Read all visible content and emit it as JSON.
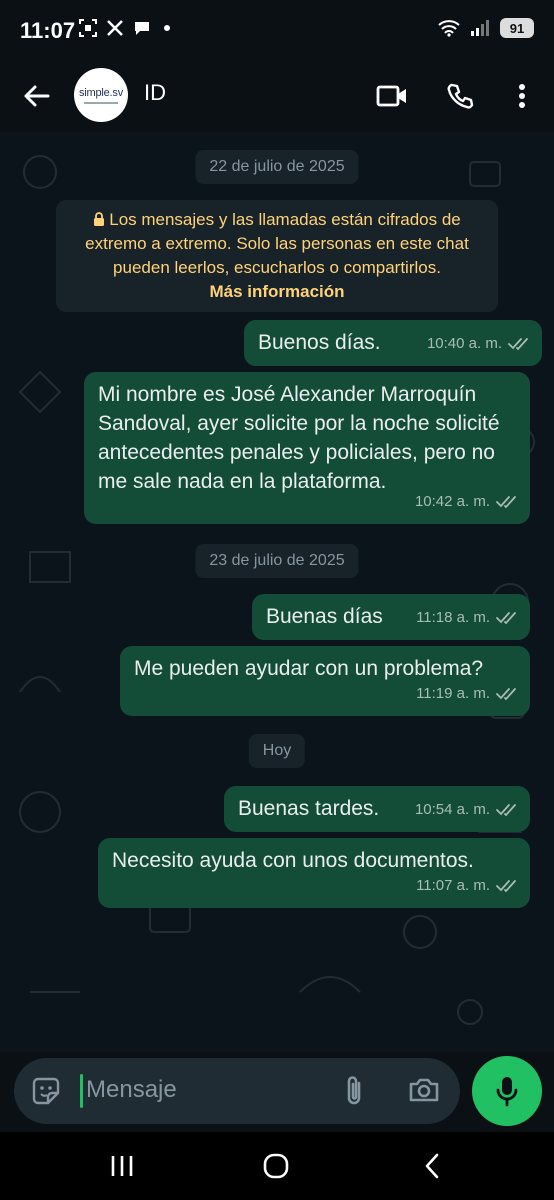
{
  "status_bar": {
    "time": "11:07",
    "battery": "91"
  },
  "header": {
    "contact_name": "ID",
    "avatar_text": "simple.sv"
  },
  "chat": {
    "date_1": "22 de julio de 2025",
    "encryption_notice": "Los mensajes y las llamadas están cifrados de extremo a extremo. Solo las personas en este chat pueden leerlos, escucharlos o compartirlos.",
    "encryption_more": "Más información",
    "messages": [
      {
        "text": "Buenos días.",
        "time": "10:40 a. m."
      },
      {
        "text": "Mi nombre  es José  Alexander Marroquín Sandoval, ayer solicite por la noche solicité antecedentes penales y policiales, pero no me sale nada en la plataforma.",
        "time": "10:42 a. m."
      },
      {
        "text": "Buenas días",
        "time": "11:18 a. m."
      },
      {
        "text": "Me pueden ayudar con un problema?",
        "time": "11:19 a. m."
      },
      {
        "text": "Buenas tardes.",
        "time": "10:54 a. m."
      },
      {
        "text": "Necesito ayuda con unos documentos.",
        "time": "11:07 a. m."
      }
    ],
    "date_2": "23 de julio de 2025",
    "date_3": "Hoy"
  },
  "composer": {
    "placeholder": "Mensaje"
  },
  "colors": {
    "bubble_out": "#144d37",
    "accent": "#21c063",
    "notice_text": "#ffd279",
    "tick": "#a7bdb3"
  }
}
